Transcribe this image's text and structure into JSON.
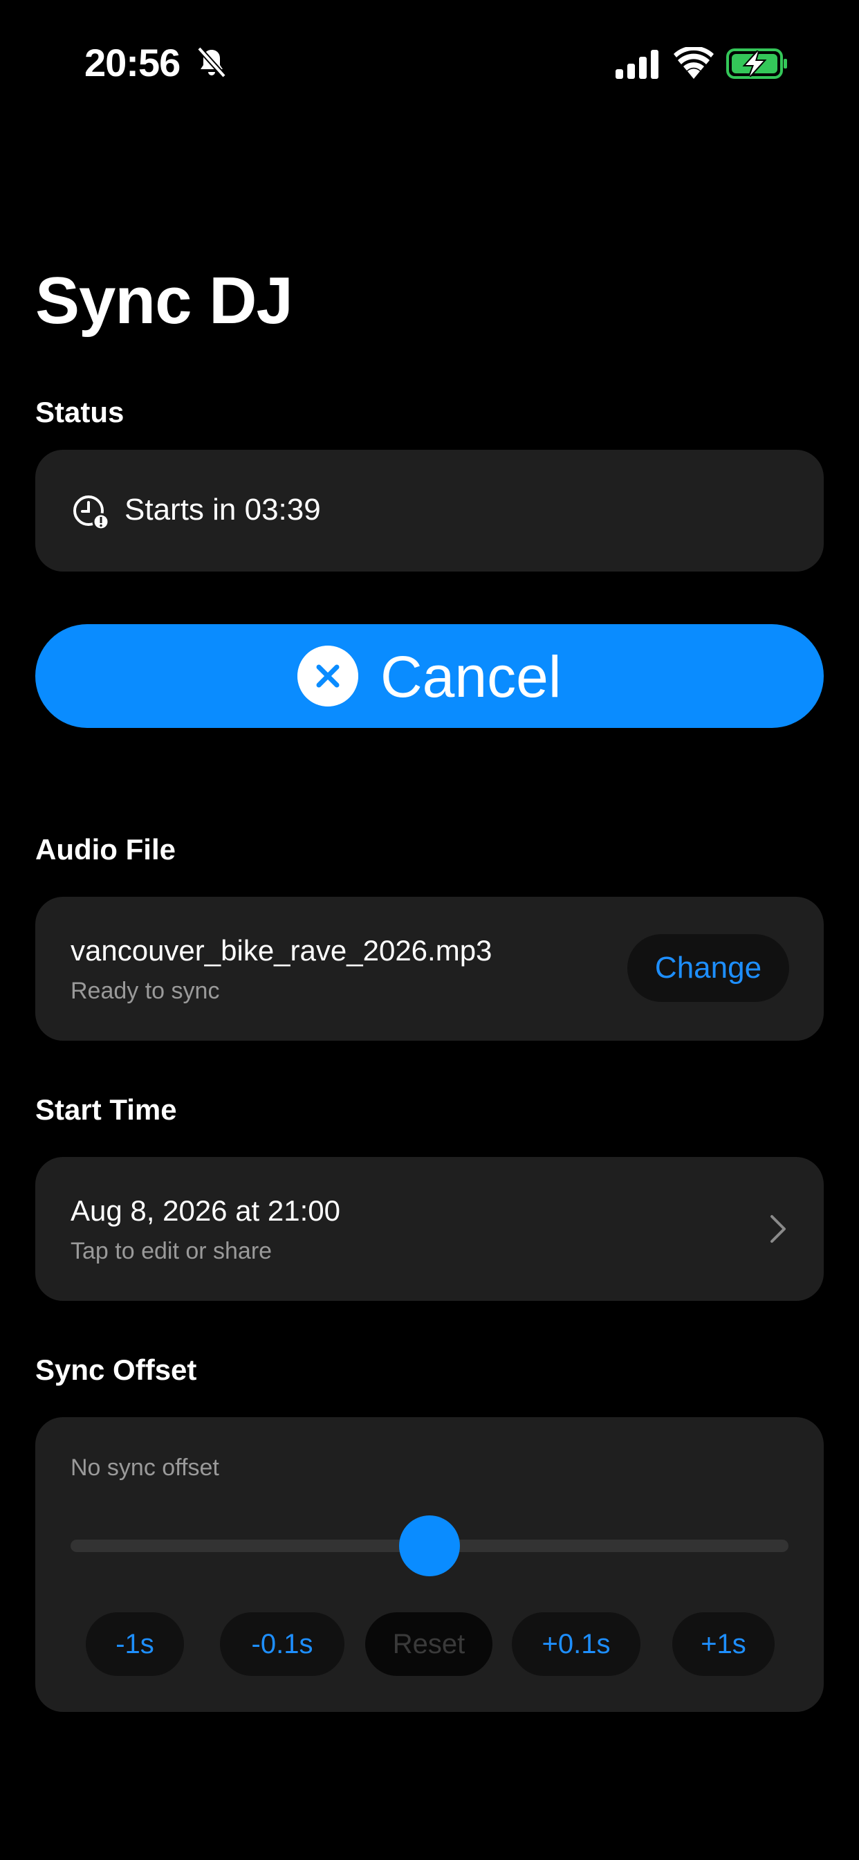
{
  "status_bar": {
    "time": "20:56",
    "icons": [
      "bell-slash-icon",
      "cellular-signal-icon",
      "wifi-icon",
      "battery-charging-icon"
    ]
  },
  "title": "Sync DJ",
  "status": {
    "header": "Status",
    "icon": "clock-alert-icon",
    "text": "Starts in 03:39"
  },
  "cancel": {
    "icon": "x-circle-icon",
    "label": "Cancel"
  },
  "audio_file": {
    "header": "Audio File",
    "name": "vancouver_bike_rave_2026.mp3",
    "subtitle": "Ready to sync",
    "change_label": "Change"
  },
  "start_time": {
    "header": "Start Time",
    "value": "Aug 8, 2026 at 21:00",
    "subtitle": "Tap to edit or share",
    "icon": "chevron-right-icon"
  },
  "sync_offset": {
    "header": "Sync Offset",
    "status": "No sync offset",
    "slider_level": 0.5,
    "buttons": {
      "minus_1": "-1s",
      "minus_01": "-0.1s",
      "reset": "Reset",
      "plus_01": "+0.1s",
      "plus_1": "+1s"
    }
  },
  "colors": {
    "accent": "#0a8cff",
    "background": "#000000",
    "card": "#1f1f1f",
    "battery_green": "#34c759"
  }
}
